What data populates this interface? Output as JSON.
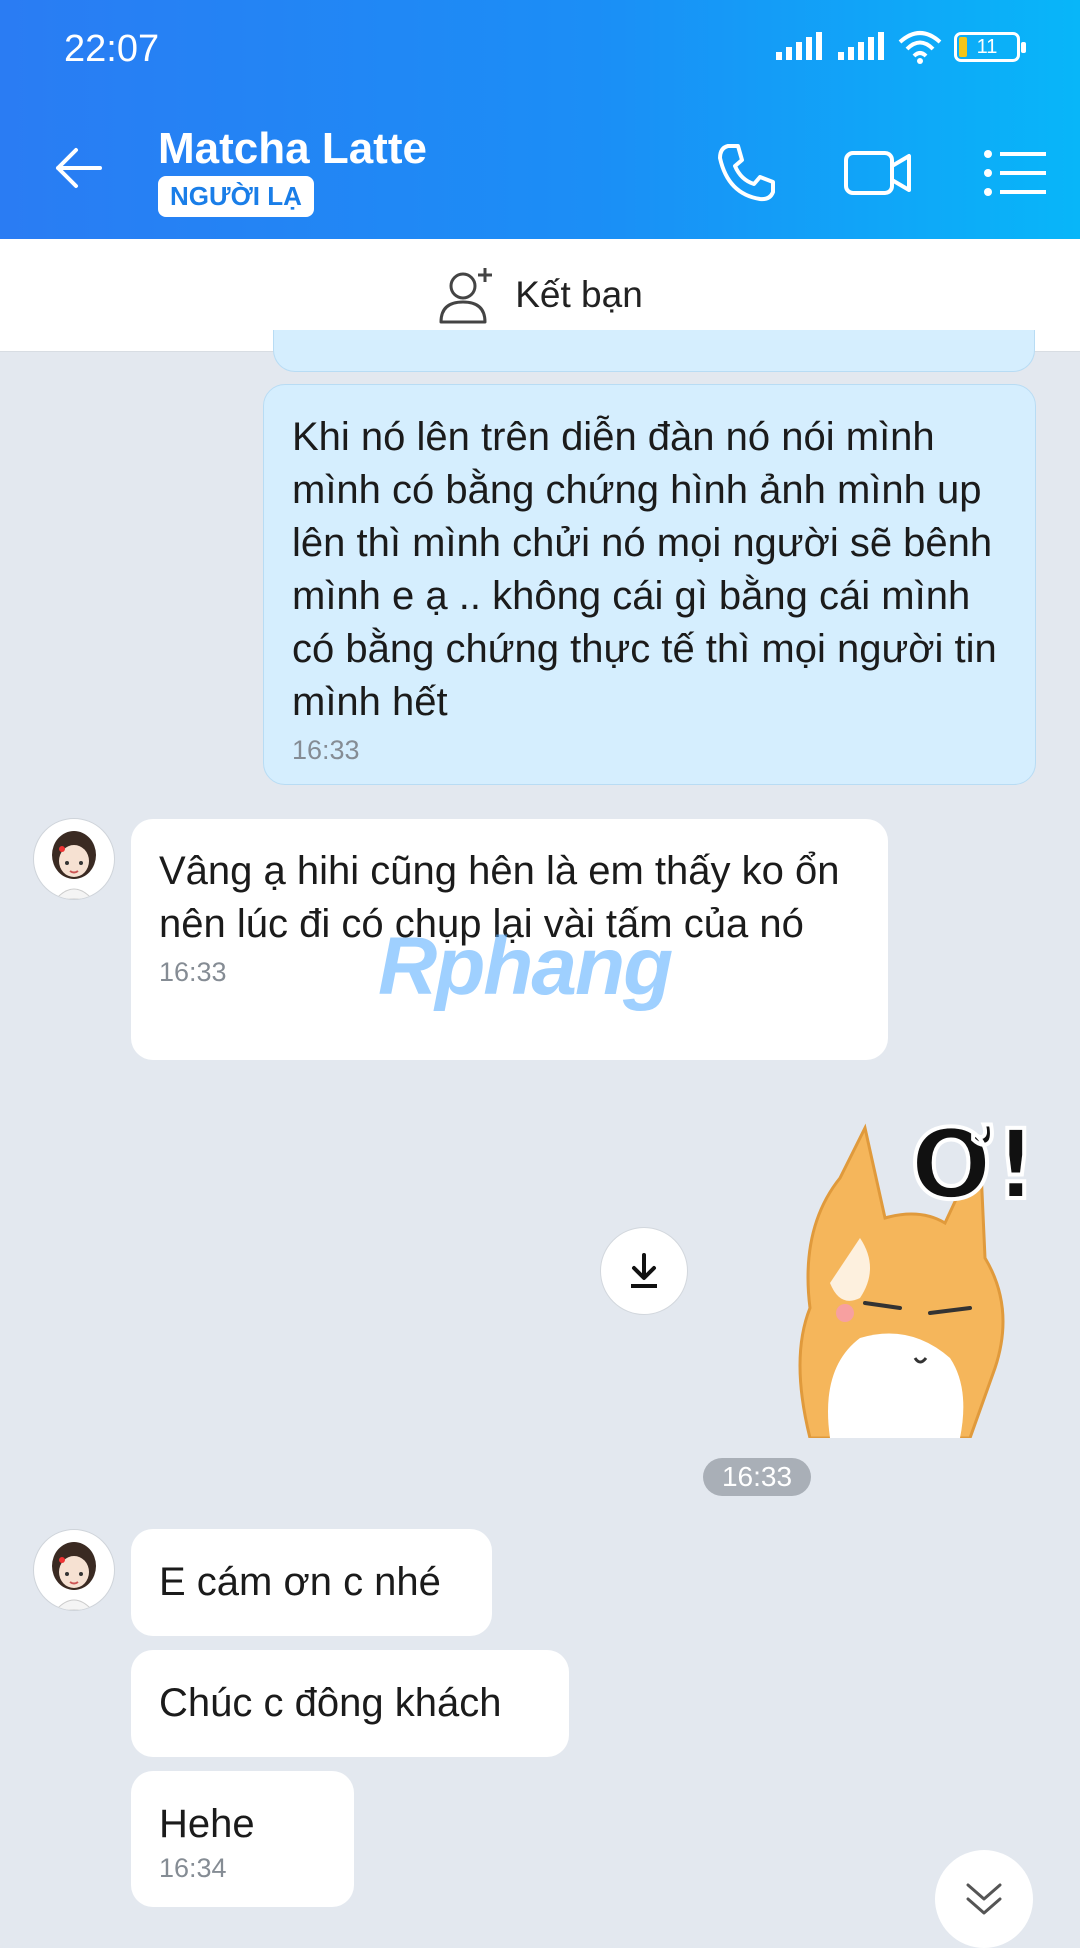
{
  "status": {
    "time": "22:07",
    "battery": "11"
  },
  "header": {
    "title": "Matcha Latte",
    "badge": "NGƯỜI LẠ"
  },
  "add_friend": {
    "label": "Kết bạn"
  },
  "messages": [
    {
      "direction": "out",
      "text": "Khi nó lên trên diễn đàn nó nói mình mình có bằng chứng hình ảnh mình up lên thì mình chửi nó mọi người sẽ bênh mình e ạ .. không cái gì bằng cái mình có bằng chứng thực tế thì mọi người tin mình hết",
      "time": "16:33"
    },
    {
      "direction": "in",
      "text": "Vâng ạ hihi cũng hên là em thấy ko ổn nên lúc đi có chụp lại vài tấm của nó",
      "time": "16:33"
    },
    {
      "direction": "out",
      "type": "sticker",
      "sticker_text": "Ơ!",
      "time": "16:33"
    },
    {
      "direction": "in",
      "text": "E cám ơn c nhé"
    },
    {
      "direction": "in",
      "text": "Chúc c đông khách"
    },
    {
      "direction": "in",
      "text": "Hehe",
      "time": "16:34"
    }
  ],
  "watermark": "Rphang",
  "icons": [
    "back-arrow-icon",
    "phone-icon",
    "video-icon",
    "menu-icon",
    "add-user-icon",
    "download-icon",
    "chevron-double-down-icon"
  ]
}
